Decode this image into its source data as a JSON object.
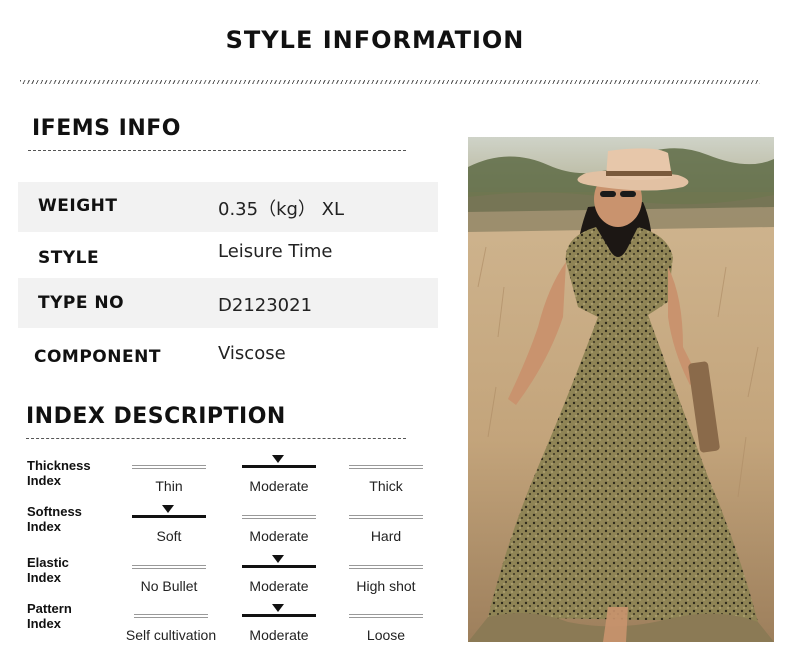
{
  "page_title": "STYLE INFORMATION",
  "items_info": {
    "title": "IFEMS INFO",
    "rows": [
      {
        "label": "WEIGHT",
        "value": "0.35（kg） XL"
      },
      {
        "label": "STYLE",
        "value": "Leisure Time"
      },
      {
        "label": "TYPE NO",
        "value": "D2123021"
      },
      {
        "label": "COMPONENT",
        "value": "Viscose"
      }
    ]
  },
  "index_description": {
    "title": "INDEX DESCRIPTION",
    "rows": [
      {
        "label_line1": "Thickness",
        "label_line2": "Index",
        "options": [
          "Thin",
          "Moderate",
          "Thick"
        ],
        "selected": 1
      },
      {
        "label_line1": "Softness",
        "label_line2": "Index",
        "options": [
          "Soft",
          "Moderate",
          "Hard"
        ],
        "selected": 0
      },
      {
        "label_line1": "Elastic",
        "label_line2": "Index",
        "options": [
          "No Bullet",
          "Moderate",
          "High shot"
        ],
        "selected": 1
      },
      {
        "label_line1": "Pattern",
        "label_line2": "Index",
        "options": [
          "Self cultivation",
          "Moderate",
          "Loose"
        ],
        "selected": 1
      }
    ]
  },
  "colors": {
    "row_shade": "#f2f2f2",
    "dress": "#8a7d4e",
    "hat": "#e6c5a8",
    "field": "#c8ad86"
  }
}
